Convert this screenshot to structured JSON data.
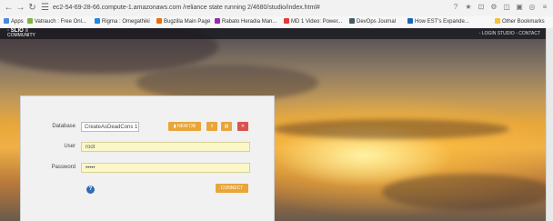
{
  "browser": {
    "url": "ec2-54-69-28-66.compute-1.amazonaws.com /reliance state running 2/4680/studio/index.html#",
    "bookmarks": [
      {
        "label": "Apps",
        "color": "#4a86e8"
      },
      {
        "label": "Vatrauch : Free Onl...",
        "color": "#7cb342"
      },
      {
        "label": "Rigma : Omegathiki",
        "color": "#1e88e5"
      },
      {
        "label": "Bugzilla Main Page",
        "color": "#ef6c00"
      },
      {
        "label": "Rabato Heradia Man...",
        "color": "#9c27b0"
      },
      {
        "label": "MD 1 Video: Power...",
        "color": "#e53935"
      },
      {
        "label": "DevOps Journal",
        "color": "#455a64"
      },
      {
        "label": "How EST's Expande...",
        "color": "#1565c0"
      },
      {
        "label": "Other Bookmarks",
        "color": "#fbc02d"
      }
    ]
  },
  "app": {
    "logo_line1": "◦ SLIO ≡",
    "logo_line2": "COMMUNITY",
    "header_right": "◦ LOGIN STUDIO ◦ CONTACT"
  },
  "login": {
    "database_label": "Database",
    "database_value": "CreateAsDeadCons 1",
    "new_db_label": "▮ NEW DB",
    "username_label": "User",
    "username_value": "root",
    "password_label": "Password",
    "password_value": "•••••",
    "connect_label": "CONNECT",
    "help_symbol": "?"
  }
}
